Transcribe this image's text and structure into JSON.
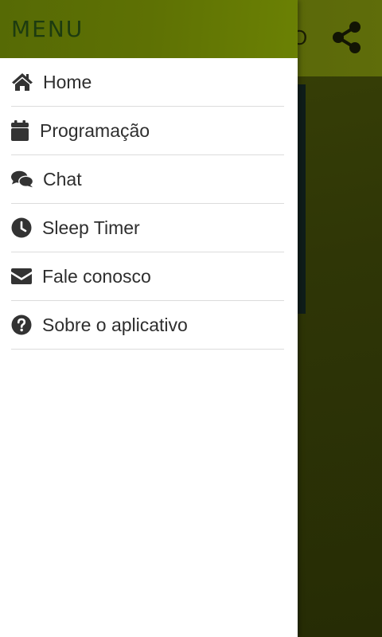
{
  "background": {
    "header_title": "…",
    "share_icon": "share-icon"
  },
  "drawer": {
    "title": "MENU",
    "items": [
      {
        "label": "Home",
        "icon": "home-icon"
      },
      {
        "label": "Programação",
        "icon": "calendar-icon"
      },
      {
        "label": "Chat",
        "icon": "chat-icon"
      },
      {
        "label": "Sleep Timer",
        "icon": "clock-icon"
      },
      {
        "label": "Fale conosco",
        "icon": "envelope-icon"
      },
      {
        "label": "Sobre o aplicativo",
        "icon": "question-circle-icon"
      }
    ]
  },
  "colors": {
    "drawer_header": "#5e7104",
    "drawer_title": "#1d3b10",
    "menu_text": "#2e2e2e",
    "divider": "#dcdcdc"
  }
}
